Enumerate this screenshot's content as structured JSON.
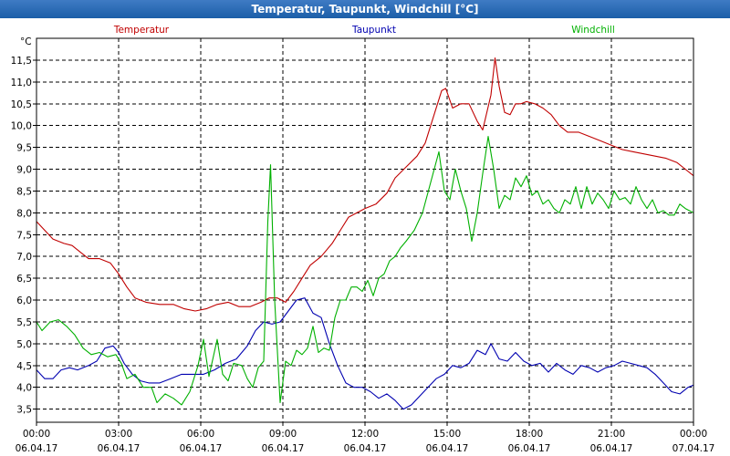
{
  "window": {
    "title": "Temperatur, Taupunkt, Windchill [°C]"
  },
  "chart_data": {
    "type": "line",
    "unit_label": "°C",
    "ylim": [
      3.2,
      12.0
    ],
    "y_ticks": [
      "3,5",
      "4,0",
      "4,5",
      "5,0",
      "5,5",
      "6,0",
      "6,5",
      "7,0",
      "7,5",
      "8,0",
      "8,5",
      "9,0",
      "9,5",
      "10,0",
      "10,5",
      "11,0",
      "11,5"
    ],
    "y_tick_values": [
      3.5,
      4.0,
      4.5,
      5.0,
      5.5,
      6.0,
      6.5,
      7.0,
      7.5,
      8.0,
      8.5,
      9.0,
      9.5,
      10.0,
      10.5,
      11.0,
      11.5
    ],
    "x_ticks": [
      {
        "h": 0,
        "time": "00:00",
        "date": "06.04.17"
      },
      {
        "h": 3,
        "time": "03:00",
        "date": "06.04.17"
      },
      {
        "h": 6,
        "time": "06:00",
        "date": "06.04.17"
      },
      {
        "h": 9,
        "time": "09:00",
        "date": "06.04.17"
      },
      {
        "h": 12,
        "time": "12:00",
        "date": "06.04.17"
      },
      {
        "h": 15,
        "time": "15:00",
        "date": "06.04.17"
      },
      {
        "h": 18,
        "time": "18:00",
        "date": "06.04.17"
      },
      {
        "h": 21,
        "time": "21:00",
        "date": "06.04.17"
      },
      {
        "h": 24,
        "time": "00:00",
        "date": "07.04.17"
      }
    ],
    "grid": true,
    "legend_position": "top",
    "series": [
      {
        "name": "Temperatur",
        "color": "#c00000",
        "points": [
          [
            0,
            7.8
          ],
          [
            0.3,
            7.6
          ],
          [
            0.6,
            7.4
          ],
          [
            1.0,
            7.3
          ],
          [
            1.3,
            7.25
          ],
          [
            1.6,
            7.1
          ],
          [
            1.9,
            6.95
          ],
          [
            2.3,
            6.95
          ],
          [
            2.7,
            6.85
          ],
          [
            3.0,
            6.6
          ],
          [
            3.3,
            6.3
          ],
          [
            3.6,
            6.05
          ],
          [
            4.0,
            5.95
          ],
          [
            4.5,
            5.9
          ],
          [
            5.0,
            5.9
          ],
          [
            5.4,
            5.8
          ],
          [
            5.8,
            5.75
          ],
          [
            6.2,
            5.8
          ],
          [
            6.6,
            5.9
          ],
          [
            7.0,
            5.95
          ],
          [
            7.4,
            5.85
          ],
          [
            7.8,
            5.85
          ],
          [
            8.2,
            5.95
          ],
          [
            8.5,
            6.05
          ],
          [
            8.8,
            6.05
          ],
          [
            9.1,
            5.95
          ],
          [
            9.4,
            6.2
          ],
          [
            9.7,
            6.5
          ],
          [
            10.0,
            6.8
          ],
          [
            10.4,
            7.0
          ],
          [
            10.8,
            7.3
          ],
          [
            11.1,
            7.6
          ],
          [
            11.4,
            7.9
          ],
          [
            11.7,
            8.0
          ],
          [
            12.0,
            8.1
          ],
          [
            12.4,
            8.2
          ],
          [
            12.8,
            8.45
          ],
          [
            13.1,
            8.8
          ],
          [
            13.5,
            9.05
          ],
          [
            13.9,
            9.3
          ],
          [
            14.2,
            9.6
          ],
          [
            14.5,
            10.2
          ],
          [
            14.8,
            10.8
          ],
          [
            14.95,
            10.85
          ],
          [
            15.2,
            10.4
          ],
          [
            15.5,
            10.5
          ],
          [
            15.8,
            10.5
          ],
          [
            16.1,
            10.1
          ],
          [
            16.3,
            9.9
          ],
          [
            16.6,
            10.7
          ],
          [
            16.75,
            11.55
          ],
          [
            16.9,
            10.9
          ],
          [
            17.1,
            10.3
          ],
          [
            17.3,
            10.25
          ],
          [
            17.5,
            10.5
          ],
          [
            17.7,
            10.5
          ],
          [
            17.9,
            10.55
          ],
          [
            18.2,
            10.5
          ],
          [
            18.5,
            10.4
          ],
          [
            18.8,
            10.25
          ],
          [
            19.1,
            10.0
          ],
          [
            19.4,
            9.85
          ],
          [
            19.8,
            9.85
          ],
          [
            20.2,
            9.75
          ],
          [
            20.6,
            9.65
          ],
          [
            21.0,
            9.55
          ],
          [
            21.4,
            9.45
          ],
          [
            21.8,
            9.4
          ],
          [
            22.2,
            9.35
          ],
          [
            22.6,
            9.3
          ],
          [
            23.0,
            9.25
          ],
          [
            23.4,
            9.15
          ],
          [
            23.7,
            9.0
          ],
          [
            24.0,
            8.85
          ]
        ]
      },
      {
        "name": "Taupunkt",
        "color": "#0000b0",
        "points": [
          [
            0,
            4.4
          ],
          [
            0.3,
            4.2
          ],
          [
            0.6,
            4.2
          ],
          [
            0.9,
            4.4
          ],
          [
            1.2,
            4.45
          ],
          [
            1.5,
            4.4
          ],
          [
            1.9,
            4.5
          ],
          [
            2.2,
            4.6
          ],
          [
            2.5,
            4.9
          ],
          [
            2.8,
            4.95
          ],
          [
            3.0,
            4.8
          ],
          [
            3.2,
            4.55
          ],
          [
            3.5,
            4.3
          ],
          [
            3.8,
            4.15
          ],
          [
            4.1,
            4.1
          ],
          [
            4.5,
            4.1
          ],
          [
            4.9,
            4.2
          ],
          [
            5.3,
            4.3
          ],
          [
            5.7,
            4.3
          ],
          [
            6.1,
            4.3
          ],
          [
            6.5,
            4.4
          ],
          [
            6.9,
            4.55
          ],
          [
            7.3,
            4.65
          ],
          [
            7.7,
            4.95
          ],
          [
            8.0,
            5.3
          ],
          [
            8.3,
            5.5
          ],
          [
            8.6,
            5.45
          ],
          [
            8.9,
            5.5
          ],
          [
            9.2,
            5.75
          ],
          [
            9.5,
            6.0
          ],
          [
            9.8,
            6.05
          ],
          [
            10.1,
            5.7
          ],
          [
            10.4,
            5.6
          ],
          [
            10.7,
            5.0
          ],
          [
            11.0,
            4.5
          ],
          [
            11.3,
            4.1
          ],
          [
            11.6,
            4.0
          ],
          [
            11.9,
            4.0
          ],
          [
            12.2,
            3.9
          ],
          [
            12.5,
            3.75
          ],
          [
            12.8,
            3.85
          ],
          [
            13.1,
            3.7
          ],
          [
            13.4,
            3.5
          ],
          [
            13.7,
            3.6
          ],
          [
            14.0,
            3.8
          ],
          [
            14.3,
            4.0
          ],
          [
            14.6,
            4.2
          ],
          [
            14.9,
            4.3
          ],
          [
            15.2,
            4.5
          ],
          [
            15.5,
            4.45
          ],
          [
            15.8,
            4.55
          ],
          [
            16.1,
            4.85
          ],
          [
            16.4,
            4.75
          ],
          [
            16.6,
            5.0
          ],
          [
            16.9,
            4.65
          ],
          [
            17.2,
            4.6
          ],
          [
            17.5,
            4.8
          ],
          [
            17.8,
            4.6
          ],
          [
            18.1,
            4.5
          ],
          [
            18.4,
            4.55
          ],
          [
            18.7,
            4.35
          ],
          [
            19.0,
            4.55
          ],
          [
            19.3,
            4.4
          ],
          [
            19.6,
            4.3
          ],
          [
            19.9,
            4.5
          ],
          [
            20.2,
            4.45
          ],
          [
            20.5,
            4.35
          ],
          [
            20.8,
            4.45
          ],
          [
            21.1,
            4.5
          ],
          [
            21.4,
            4.6
          ],
          [
            21.7,
            4.55
          ],
          [
            22.0,
            4.5
          ],
          [
            22.3,
            4.45
          ],
          [
            22.6,
            4.3
          ],
          [
            22.9,
            4.1
          ],
          [
            23.2,
            3.9
          ],
          [
            23.5,
            3.85
          ],
          [
            23.8,
            4.0
          ],
          [
            24.0,
            4.05
          ]
        ]
      },
      {
        "name": "Windchill",
        "color": "#00b000",
        "points": [
          [
            0,
            5.5
          ],
          [
            0.2,
            5.3
          ],
          [
            0.5,
            5.5
          ],
          [
            0.8,
            5.55
          ],
          [
            1.1,
            5.4
          ],
          [
            1.4,
            5.2
          ],
          [
            1.7,
            4.9
          ],
          [
            2.0,
            4.75
          ],
          [
            2.3,
            4.8
          ],
          [
            2.6,
            4.7
          ],
          [
            2.9,
            4.75
          ],
          [
            3.1,
            4.55
          ],
          [
            3.3,
            4.2
          ],
          [
            3.6,
            4.3
          ],
          [
            3.9,
            4.0
          ],
          [
            4.2,
            4.0
          ],
          [
            4.4,
            3.65
          ],
          [
            4.7,
            3.85
          ],
          [
            5.0,
            3.75
          ],
          [
            5.3,
            3.6
          ],
          [
            5.6,
            3.9
          ],
          [
            5.9,
            4.5
          ],
          [
            6.1,
            5.1
          ],
          [
            6.3,
            4.25
          ],
          [
            6.6,
            5.1
          ],
          [
            6.8,
            4.3
          ],
          [
            7.0,
            4.15
          ],
          [
            7.2,
            4.55
          ],
          [
            7.5,
            4.5
          ],
          [
            7.7,
            4.2
          ],
          [
            7.9,
            4.0
          ],
          [
            8.1,
            4.45
          ],
          [
            8.3,
            4.6
          ],
          [
            8.45,
            7.8
          ],
          [
            8.55,
            9.1
          ],
          [
            8.7,
            6.0
          ],
          [
            8.9,
            3.65
          ],
          [
            9.1,
            4.6
          ],
          [
            9.3,
            4.5
          ],
          [
            9.5,
            4.85
          ],
          [
            9.7,
            4.75
          ],
          [
            9.9,
            4.9
          ],
          [
            10.1,
            5.4
          ],
          [
            10.3,
            4.8
          ],
          [
            10.5,
            4.9
          ],
          [
            10.7,
            4.85
          ],
          [
            10.9,
            5.6
          ],
          [
            11.1,
            6.0
          ],
          [
            11.3,
            6.0
          ],
          [
            11.5,
            6.3
          ],
          [
            11.7,
            6.3
          ],
          [
            11.9,
            6.2
          ],
          [
            12.1,
            6.45
          ],
          [
            12.3,
            6.1
          ],
          [
            12.5,
            6.5
          ],
          [
            12.7,
            6.6
          ],
          [
            12.9,
            6.9
          ],
          [
            13.1,
            7.0
          ],
          [
            13.3,
            7.2
          ],
          [
            13.5,
            7.35
          ],
          [
            13.8,
            7.6
          ],
          [
            14.1,
            8.0
          ],
          [
            14.4,
            8.7
          ],
          [
            14.7,
            9.4
          ],
          [
            14.9,
            8.5
          ],
          [
            15.1,
            8.3
          ],
          [
            15.3,
            9.0
          ],
          [
            15.5,
            8.5
          ],
          [
            15.7,
            8.1
          ],
          [
            15.9,
            7.35
          ],
          [
            16.1,
            8.0
          ],
          [
            16.3,
            8.9
          ],
          [
            16.5,
            9.75
          ],
          [
            16.7,
            9.0
          ],
          [
            16.9,
            8.1
          ],
          [
            17.1,
            8.4
          ],
          [
            17.3,
            8.3
          ],
          [
            17.5,
            8.8
          ],
          [
            17.7,
            8.6
          ],
          [
            17.9,
            8.85
          ],
          [
            18.1,
            8.4
          ],
          [
            18.3,
            8.5
          ],
          [
            18.5,
            8.2
          ],
          [
            18.7,
            8.3
          ],
          [
            18.9,
            8.1
          ],
          [
            19.1,
            8.0
          ],
          [
            19.3,
            8.3
          ],
          [
            19.5,
            8.2
          ],
          [
            19.7,
            8.6
          ],
          [
            19.9,
            8.1
          ],
          [
            20.1,
            8.6
          ],
          [
            20.3,
            8.2
          ],
          [
            20.5,
            8.45
          ],
          [
            20.7,
            8.3
          ],
          [
            20.9,
            8.1
          ],
          [
            21.1,
            8.5
          ],
          [
            21.3,
            8.3
          ],
          [
            21.5,
            8.35
          ],
          [
            21.7,
            8.2
          ],
          [
            21.9,
            8.6
          ],
          [
            22.1,
            8.3
          ],
          [
            22.3,
            8.1
          ],
          [
            22.5,
            8.3
          ],
          [
            22.7,
            8.0
          ],
          [
            22.9,
            8.05
          ],
          [
            23.1,
            7.95
          ],
          [
            23.3,
            7.95
          ],
          [
            23.5,
            8.2
          ],
          [
            23.7,
            8.1
          ],
          [
            24.0,
            8.0
          ]
        ]
      }
    ]
  }
}
